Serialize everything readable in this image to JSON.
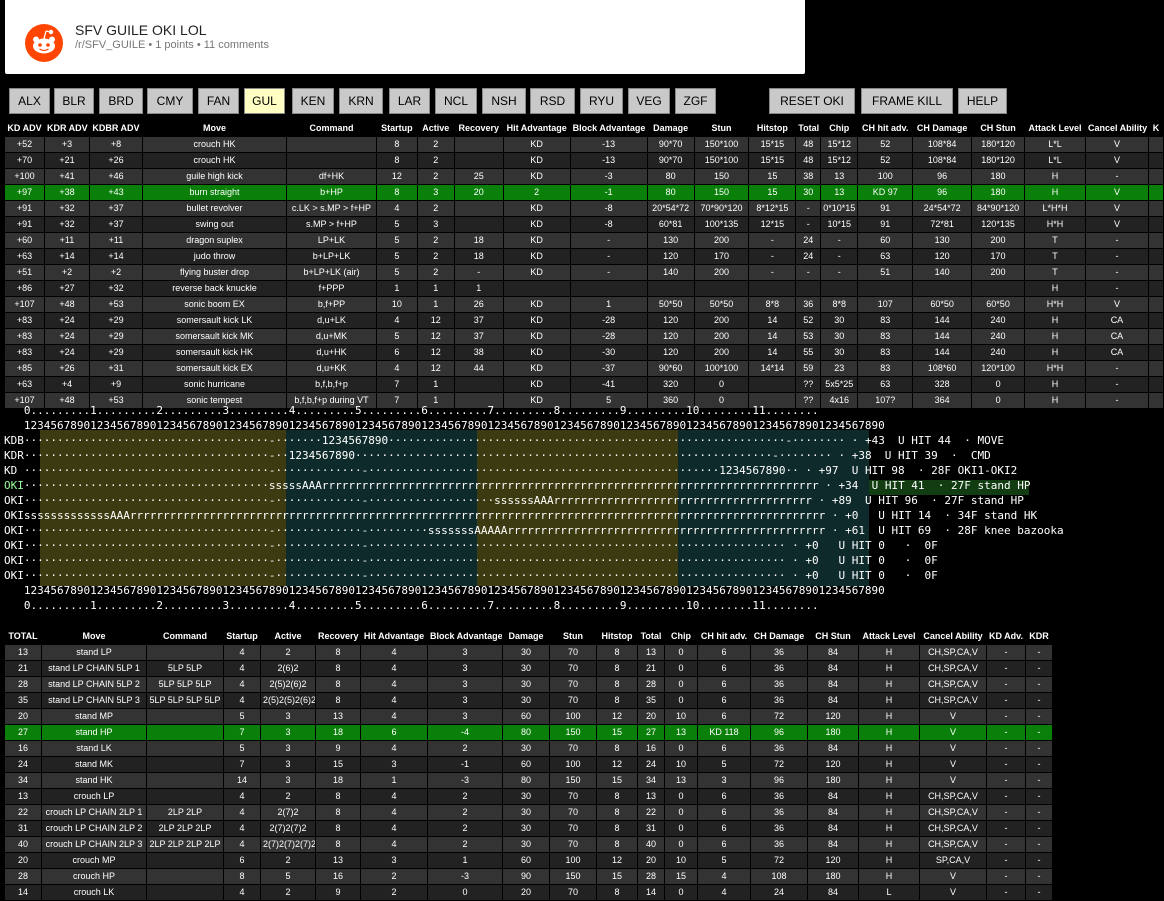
{
  "post": {
    "title": "SFV GUILE OKI LOL",
    "subreddit": "/r/SFV_GUILE",
    "meta": " • 1 points • 11 comments"
  },
  "chars": [
    "ALX",
    "BLR",
    "BRD",
    "CMY",
    "FAN",
    "GUL",
    "KEN",
    "KRN",
    "LAR",
    "NCL",
    "NSH",
    "RSD",
    "RYU",
    "VEG",
    "ZGF"
  ],
  "selected_char": "GUL",
  "actions": [
    "RESET OKI",
    "FRAME KILL",
    "HELP"
  ],
  "top_table": {
    "headers": [
      "KD ADV",
      "KDR ADV",
      "KDBR ADV",
      "Move",
      "Command",
      "Startup",
      "Active",
      "Recovery",
      "Hit Advantage",
      "Block Advantage",
      "Damage",
      "Stun",
      "Hitstop",
      "Total",
      "Chip",
      "CH hit adv.",
      "CH Damage",
      "CH Stun",
      "Attack Level",
      "Cancel Ability",
      "K"
    ],
    "rows": [
      [
        "+52",
        "+3",
        "+8",
        "crouch HK",
        "",
        "8",
        "2",
        "",
        "KD",
        "-13",
        "90*70",
        "150*100",
        "15*15",
        "48",
        "15*12",
        "52",
        "108*84",
        "180*120",
        "L*L",
        "V",
        ""
      ],
      [
        "+70",
        "+21",
        "+26",
        "crouch HK",
        "",
        "8",
        "2",
        "",
        "KD",
        "-13",
        "90*70",
        "150*100",
        "15*15",
        "48",
        "15*12",
        "52",
        "108*84",
        "180*120",
        "L*L",
        "V",
        ""
      ],
      [
        "+100",
        "+41",
        "+46",
        "guile high kick",
        "df+HK",
        "12",
        "2",
        "25",
        "KD",
        "-3",
        "80",
        "150",
        "15",
        "38",
        "13",
        "100",
        "96",
        "180",
        "H",
        "-",
        ""
      ],
      [
        "+97",
        "+38",
        "+43",
        "burn straight",
        "b+HP",
        "8",
        "3",
        "20",
        "2",
        "-1",
        "80",
        "150",
        "15",
        "30",
        "13",
        "KD 97",
        "96",
        "180",
        "H",
        "V",
        ""
      ],
      [
        "+91",
        "+32",
        "+37",
        "bullet revolver",
        "c.LK > s.MP > f+HP",
        "4",
        "2",
        "",
        "KD",
        "-8",
        "20*54*72",
        "70*90*120",
        "8*12*15",
        "-",
        "0*10*15",
        "91",
        "24*54*72",
        "84*90*120",
        "L*H*H",
        "V",
        ""
      ],
      [
        "+91",
        "+32",
        "+37",
        "swing out",
        "s.MP > f+HP",
        "5",
        "3",
        "",
        "KD",
        "-8",
        "60*81",
        "100*135",
        "12*15",
        "-",
        "10*15",
        "91",
        "72*81",
        "120*135",
        "H*H",
        "V",
        ""
      ],
      [
        "+60",
        "+11",
        "+11",
        "dragon suplex",
        "LP+LK",
        "5",
        "2",
        "18",
        "KD",
        "-",
        "130",
        "200",
        "-",
        "24",
        "-",
        "60",
        "130",
        "200",
        "T",
        "-",
        ""
      ],
      [
        "+63",
        "+14",
        "+14",
        "judo throw",
        "b+LP+LK",
        "5",
        "2",
        "18",
        "KD",
        "-",
        "120",
        "170",
        "-",
        "24",
        "-",
        "63",
        "120",
        "170",
        "T",
        "-",
        ""
      ],
      [
        "+51",
        "+2",
        "+2",
        "flying buster drop",
        "b+LP+LK (air)",
        "5",
        "2",
        "-",
        "KD",
        "-",
        "140",
        "200",
        "-",
        "-",
        "-",
        "51",
        "140",
        "200",
        "T",
        "-",
        ""
      ],
      [
        "+86",
        "+27",
        "+32",
        "reverse back knuckle",
        "f+PPP",
        "1",
        "1",
        "1",
        "",
        "",
        "",
        "",
        "",
        "",
        "",
        "",
        "",
        "",
        "H",
        "-",
        ""
      ],
      [
        "+107",
        "+48",
        "+53",
        "sonic boom EX",
        "b,f+PP",
        "10",
        "1",
        "26",
        "KD",
        "1",
        "50*50",
        "50*50",
        "8*8",
        "36",
        "8*8",
        "107",
        "60*50",
        "60*50",
        "H*H",
        "V",
        ""
      ],
      [
        "+83",
        "+24",
        "+29",
        "somersault kick LK",
        "d,u+LK",
        "4",
        "12",
        "37",
        "KD",
        "-28",
        "120",
        "200",
        "14",
        "52",
        "30",
        "83",
        "144",
        "240",
        "H",
        "CA",
        ""
      ],
      [
        "+83",
        "+24",
        "+29",
        "somersault kick MK",
        "d,u+MK",
        "5",
        "12",
        "37",
        "KD",
        "-28",
        "120",
        "200",
        "14",
        "53",
        "30",
        "83",
        "144",
        "240",
        "H",
        "CA",
        ""
      ],
      [
        "+83",
        "+24",
        "+29",
        "somersault kick HK",
        "d,u+HK",
        "6",
        "12",
        "38",
        "KD",
        "-30",
        "120",
        "200",
        "14",
        "55",
        "30",
        "83",
        "144",
        "240",
        "H",
        "CA",
        ""
      ],
      [
        "+85",
        "+26",
        "+31",
        "somersault kick EX",
        "d,u+KK",
        "4",
        "12",
        "44",
        "KD",
        "-37",
        "90*60",
        "100*100",
        "14*14",
        "59",
        "23",
        "83",
        "108*60",
        "120*100",
        "H*H",
        "-",
        ""
      ],
      [
        "+63",
        "+4",
        "+9",
        "sonic hurricane",
        "b,f,b,f+p",
        "7",
        "1",
        "",
        "KD",
        "-41",
        "320",
        "0",
        "",
        "??",
        "5x5*25",
        "63",
        "328",
        "0",
        "H",
        "-",
        ""
      ],
      [
        "+107",
        "+48",
        "+53",
        "sonic tempest",
        "b,f,b,f+p during VT",
        "7",
        "1",
        "",
        "KD",
        "5",
        "360",
        "0",
        "",
        "??",
        "4x16",
        "107?",
        "364",
        "0",
        "H",
        "-",
        ""
      ]
    ]
  },
  "oki": {
    "ruler_top": "0.........1.........2.........3.........4.........5.........6.........7.........8.........9.........10........11........",
    "digits": "1234567890123456789012345678901234567890123456789012345678901234567890123456789012345678901234567890123456789012345678901234567890",
    "rows": [
      {
        "label": "KDBR",
        "line": "·····································-·······1234567890····························································-········",
        "suffix": "· +43  U HIT 44  · MOVE"
      },
      {
        "label": "KDR",
        "line": "·····································-··1234567890·······························································-········",
        "suffix": "· +38  U HIT 39  ·  CMD"
      },
      {
        "label": "KD",
        "line": "·····································-·············-·····················································1234567890··",
        "suffix": "· +97  U HIT 98  · 28F OKI1-OKI2"
      },
      {
        "label": "OKI1",
        "line": "·····································sssssAAArrrrrrrrrrrrrrrrrrrrrrrrrrrrrrrrrrrrrrrrrrrrrrrrrrrrrrrrrrrrrrrrrrrrrrrrrrr",
        "suffix": "· +34  U HIT 41  · 27F stand HP"
      },
      {
        "label": "OKI2",
        "line": "·····································-·············-···················ssssssAAArrrrrrrrrrrrrrrrrrrrrrrrrrrrrrrrrrrrrrr",
        "suffix": "· +89  U HIT 96  · 27F stand HP"
      },
      {
        "label": "OKI3",
        "line": "sssssssssssssAAArrrrrrrrrrrrrrrrrrrrrrrrrrrrrrrrrrrrrrrrrrrrrrrrrrrrrrrrrrrrrrrrrrrrrrrrrrrrrrrrrrrrrrrrrrrrrrrrrrrrrrrrr",
        "suffix": "· +0   U HIT 14  · 34F stand HK"
      },
      {
        "label": "OKI4",
        "line": "·····································-·············-·········sssssssAAAAArrrrrrrrrrrrrrrrrrrrrrrrrrrrrrrrrrrrrrrrrrrrrrrr",
        "suffix": "· +61  U HIT 69  · 28F knee bazooka"
      },
      {
        "label": "OKI5",
        "line": "·····································-·············-·······························································",
        "suffix": "· +0   U HIT 0   ·  0F"
      },
      {
        "label": "OKI6",
        "line": "·····································-·············-·······························································",
        "suffix": "· +0   U HIT 0   ·  0F"
      },
      {
        "label": "OKI7",
        "line": "·····································-·············-·······························································",
        "suffix": "· +0   U HIT 0   ·  0F"
      }
    ],
    "ruler_bottom": "0.........1.........2.........3.........4.........5.........6.........7.........8.........9.........10........11........"
  },
  "bottom_table": {
    "headers": [
      "TOTAL",
      "Move",
      "Command",
      "Startup",
      "Active",
      "Recovery",
      "Hit Advantage",
      "Block Advantage",
      "Damage",
      "Stun",
      "Hitstop",
      "Total",
      "Chip",
      "CH hit adv.",
      "CH Damage",
      "CH Stun",
      "Attack Level",
      "Cancel Ability",
      "KD Adv.",
      "KDR"
    ],
    "rows": [
      [
        "13",
        "stand LP",
        "",
        "4",
        "2",
        "8",
        "4",
        "3",
        "30",
        "70",
        "8",
        "13",
        "0",
        "6",
        "36",
        "84",
        "H",
        "CH,SP,CA,V",
        "-",
        "-"
      ],
      [
        "21",
        "stand LP CHAIN 5LP 1",
        "5LP 5LP",
        "4",
        "2(6)2",
        "8",
        "4",
        "3",
        "30",
        "70",
        "8",
        "21",
        "0",
        "6",
        "36",
        "84",
        "H",
        "CH,SP,CA,V",
        "-",
        "-"
      ],
      [
        "28",
        "stand LP CHAIN 5LP 2",
        "5LP 5LP 5LP",
        "4",
        "2(5)2(6)2",
        "8",
        "4",
        "3",
        "30",
        "70",
        "8",
        "28",
        "0",
        "6",
        "36",
        "84",
        "H",
        "CH,SP,CA,V",
        "-",
        "-"
      ],
      [
        "35",
        "stand LP CHAIN 5LP 3",
        "5LP 5LP 5LP 5LP",
        "4",
        "2(5)2(5)2(6)2",
        "8",
        "4",
        "3",
        "30",
        "70",
        "8",
        "35",
        "0",
        "6",
        "36",
        "84",
        "H",
        "CH,SP,CA,V",
        "-",
        "-"
      ],
      [
        "20",
        "stand MP",
        "",
        "5",
        "3",
        "13",
        "4",
        "3",
        "60",
        "100",
        "12",
        "20",
        "10",
        "6",
        "72",
        "120",
        "H",
        "V",
        "-",
        "-"
      ],
      [
        "27",
        "stand HP",
        "",
        "7",
        "3",
        "18",
        "6",
        "-4",
        "80",
        "150",
        "15",
        "27",
        "13",
        "KD 118",
        "96",
        "180",
        "H",
        "V",
        "-",
        "-"
      ],
      [
        "16",
        "stand LK",
        "",
        "5",
        "3",
        "9",
        "4",
        "2",
        "30",
        "70",
        "8",
        "16",
        "0",
        "6",
        "36",
        "84",
        "H",
        "V",
        "-",
        "-"
      ],
      [
        "24",
        "stand MK",
        "",
        "7",
        "3",
        "15",
        "3",
        "-1",
        "60",
        "100",
        "12",
        "24",
        "10",
        "5",
        "72",
        "120",
        "H",
        "V",
        "-",
        "-"
      ],
      [
        "34",
        "stand HK",
        "",
        "14",
        "3",
        "18",
        "1",
        "-3",
        "80",
        "150",
        "15",
        "34",
        "13",
        "3",
        "96",
        "180",
        "H",
        "V",
        "-",
        "-"
      ],
      [
        "13",
        "crouch LP",
        "",
        "4",
        "2",
        "8",
        "4",
        "2",
        "30",
        "70",
        "8",
        "13",
        "0",
        "6",
        "36",
        "84",
        "H",
        "CH,SP,CA,V",
        "-",
        "-"
      ],
      [
        "22",
        "crouch LP CHAIN 2LP 1",
        "2LP 2LP",
        "4",
        "2(7)2",
        "8",
        "4",
        "2",
        "30",
        "70",
        "8",
        "22",
        "0",
        "6",
        "36",
        "84",
        "H",
        "CH,SP,CA,V",
        "-",
        "-"
      ],
      [
        "31",
        "crouch LP CHAIN 2LP 2",
        "2LP 2LP 2LP",
        "4",
        "2(7)2(7)2",
        "8",
        "4",
        "2",
        "30",
        "70",
        "8",
        "31",
        "0",
        "6",
        "36",
        "84",
        "H",
        "CH,SP,CA,V",
        "-",
        "-"
      ],
      [
        "40",
        "crouch LP CHAIN 2LP 3",
        "2LP 2LP 2LP 2LP",
        "4",
        "2(7)2(7)2(7)2",
        "8",
        "4",
        "2",
        "30",
        "70",
        "8",
        "40",
        "0",
        "6",
        "36",
        "84",
        "H",
        "CH,SP,CA,V",
        "-",
        "-"
      ],
      [
        "20",
        "crouch MP",
        "",
        "6",
        "2",
        "13",
        "3",
        "1",
        "60",
        "100",
        "12",
        "20",
        "10",
        "5",
        "72",
        "120",
        "H",
        "SP,CA,V",
        "-",
        "-"
      ],
      [
        "28",
        "crouch HP",
        "",
        "8",
        "5",
        "16",
        "2",
        "-3",
        "90",
        "150",
        "15",
        "28",
        "15",
        "4",
        "108",
        "180",
        "H",
        "V",
        "-",
        "-"
      ],
      [
        "14",
        "crouch LK",
        "",
        "4",
        "2",
        "9",
        "2",
        "0",
        "20",
        "70",
        "8",
        "14",
        "0",
        "4",
        "24",
        "84",
        "L",
        "V",
        "-",
        "-"
      ]
    ]
  }
}
